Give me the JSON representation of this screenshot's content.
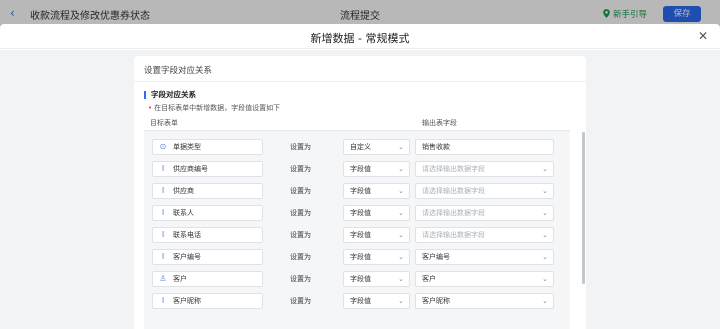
{
  "topbar": {
    "back_icon": "chevron-left-icon",
    "title_left": "收款流程及修改优惠券状态",
    "title_center": "流程提交",
    "guide_label": "新手引导",
    "save_label": "保存",
    "accent": "#2b6cf6",
    "guide_color": "#1f9d55"
  },
  "modal": {
    "title": "新增数据 - 常规模式",
    "close_icon": "close-icon"
  },
  "card": {
    "header": "设置字段对应关系",
    "section_title": "字段对应关系",
    "hint": "在目标表单中新增数据，字段值设置如下",
    "col_target": "目标表单",
    "col_source": "输出表字段"
  },
  "rows": [
    {
      "icon": "radio-icon",
      "glyph": "⊙",
      "field": "单据类型",
      "setto": "设置为",
      "mode": "自定义",
      "value": "销售收款",
      "placeholder": false,
      "has_chevron": false
    },
    {
      "icon": "text-icon",
      "glyph": "I",
      "field": "供应商编号",
      "setto": "设置为",
      "mode": "字段值",
      "value": "请选择输出数据字段",
      "placeholder": true,
      "has_chevron": true
    },
    {
      "icon": "text-icon",
      "glyph": "I",
      "field": "供应商",
      "setto": "设置为",
      "mode": "字段值",
      "value": "请选择输出数据字段",
      "placeholder": true,
      "has_chevron": true
    },
    {
      "icon": "text-icon",
      "glyph": "I",
      "field": "联系人",
      "setto": "设置为",
      "mode": "字段值",
      "value": "请选择输出数据字段",
      "placeholder": true,
      "has_chevron": true
    },
    {
      "icon": "text-icon",
      "glyph": "I",
      "field": "联系电话",
      "setto": "设置为",
      "mode": "字段值",
      "value": "请选择输出数据字段",
      "placeholder": true,
      "has_chevron": true
    },
    {
      "icon": "text-icon",
      "glyph": "I",
      "field": "客户编号",
      "setto": "设置为",
      "mode": "字段值",
      "value": "客户编号",
      "placeholder": false,
      "has_chevron": true
    },
    {
      "icon": "user-icon",
      "glyph": "♙",
      "field": "客户",
      "setto": "设置为",
      "mode": "字段值",
      "value": "客户",
      "placeholder": false,
      "has_chevron": true
    },
    {
      "icon": "text-icon",
      "glyph": "I",
      "field": "客户昵称",
      "setto": "设置为",
      "mode": "字段值",
      "value": "客户昵称",
      "placeholder": false,
      "has_chevron": true
    }
  ]
}
